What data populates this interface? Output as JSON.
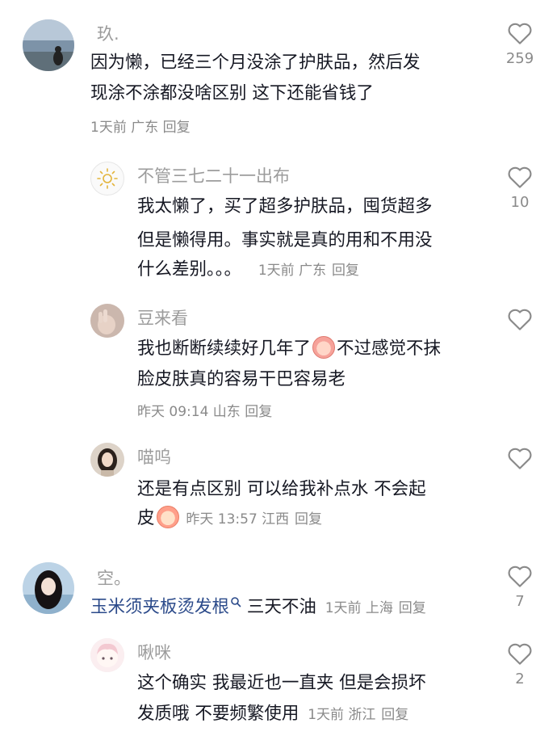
{
  "comments": [
    {
      "username": "玖.",
      "lines": [
        "因为懒，已经三个月没涂了护肤品，然后发",
        "现涂不涂都没啥区别 这下还能省钱了"
      ],
      "meta": "1天前 广东",
      "reply": "回复",
      "likes": "259",
      "avatar_icon": "lakeside-avatar"
    },
    {
      "username": "不管三七二十一出布",
      "lines": [
        "我太懒了，买了超多护肤品，囤货超多",
        "但是懒得用。事实就是真的用和不用没",
        "什么差别。。。"
      ],
      "meta": "1天前 广东",
      "reply": "回复",
      "likes": "10",
      "avatar_icon": "sun-icon"
    },
    {
      "username": "豆来看",
      "lines": [
        "我也断断续续好几年了",
        "不过感觉不抹",
        "脸皮肤真的容易干巴容易老"
      ],
      "meta": "昨天 09:14 山东",
      "reply": "回复",
      "likes": "",
      "avatar_icon": "hand-avatar"
    },
    {
      "username": "喵呜",
      "lines": [
        "还是有点区别  可以给我补点水  不会起",
        "皮"
      ],
      "meta": "昨天 13:57 江西",
      "reply": "回复",
      "likes": "",
      "avatar_icon": "girl-avatar"
    },
    {
      "username": "空。",
      "link_text": "玉米须夹板烫发根",
      "text_after": "  三天不油",
      "meta": "1天前 上海",
      "reply": "回复",
      "likes": "7",
      "avatar_icon": "long-hair-avatar"
    },
    {
      "username": "啾咪",
      "lines": [
        "这个确实 我最近也一直夹 但是会损坏",
        "发质哦 不要频繁使用"
      ],
      "meta": "1天前 浙江",
      "reply": "回复",
      "likes": "2",
      "avatar_icon": "cartoon-avatar"
    }
  ]
}
